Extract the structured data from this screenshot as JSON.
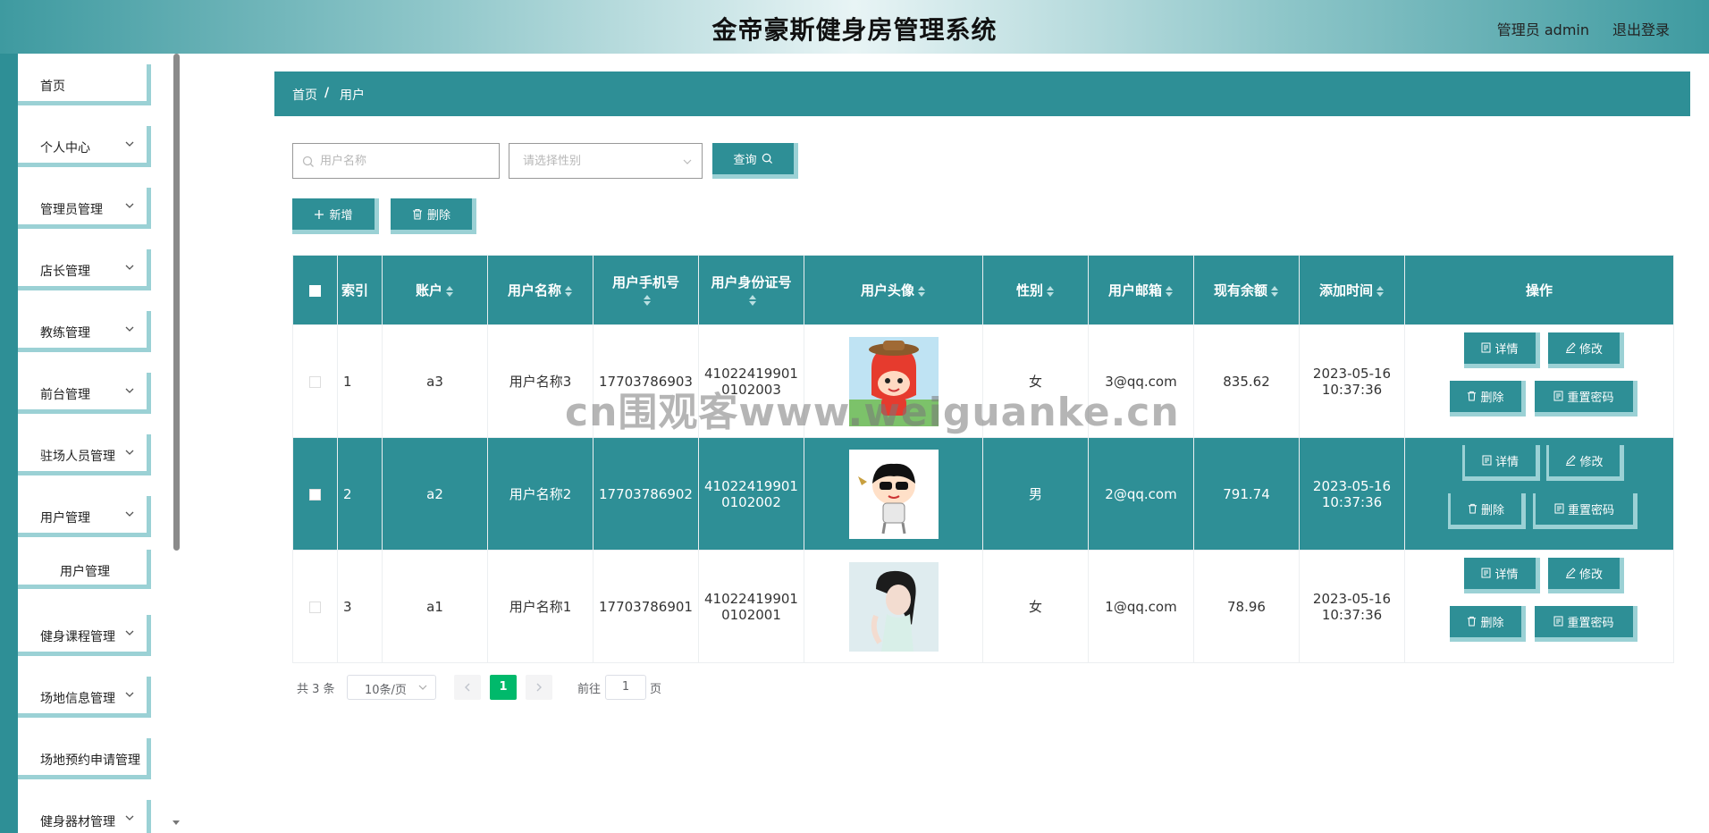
{
  "header": {
    "title": "金帝豪斯健身房管理系统",
    "admin": "管理员 admin",
    "logout": "退出登录"
  },
  "sidebar": {
    "items": [
      {
        "label": "首页"
      },
      {
        "label": "个人中心"
      },
      {
        "label": "管理员管理"
      },
      {
        "label": "店长管理"
      },
      {
        "label": "教练管理"
      },
      {
        "label": "前台管理"
      },
      {
        "label": "驻场人员管理"
      },
      {
        "label": "用户管理"
      },
      {
        "label": "用户管理"
      },
      {
        "label": "健身课程管理"
      },
      {
        "label": "场地信息管理"
      },
      {
        "label": "场地预约申请管理"
      },
      {
        "label": "健身器材管理"
      }
    ]
  },
  "breadcrumb": {
    "home": "首页",
    "sep": "/",
    "current": "用户"
  },
  "search": {
    "name_placeholder": "用户名称",
    "gender_placeholder": "请选择性别",
    "query_label": "查询"
  },
  "actions": {
    "add_label": "新增",
    "delete_label": "删除"
  },
  "table": {
    "headers": [
      "索引",
      "账户",
      "用户名称",
      "用户手机号",
      "用户身份证号",
      "用户头像",
      "性别",
      "用户邮箱",
      "现有余额",
      "添加时间",
      "操作"
    ],
    "rows": [
      {
        "index": "1",
        "account": "a3",
        "name": "用户名称3",
        "phone": "17703786903",
        "idcard": "410224199010102003",
        "gender": "女",
        "email": "3@qq.com",
        "balance": "835.62",
        "date": "2023-05-16",
        "time": "10:37:36"
      },
      {
        "index": "2",
        "account": "a2",
        "name": "用户名称2",
        "phone": "17703786902",
        "idcard": "410224199010102002",
        "gender": "男",
        "email": "2@qq.com",
        "balance": "791.74",
        "date": "2023-05-16",
        "time": "10:37:36"
      },
      {
        "index": "3",
        "account": "a1",
        "name": "用户名称1",
        "phone": "17703786901",
        "idcard": "410224199010102001",
        "gender": "女",
        "email": "1@qq.com",
        "balance": "78.96",
        "date": "2023-05-16",
        "time": "10:37:36"
      }
    ],
    "op_labels": {
      "detail": "详情",
      "edit": "修改",
      "delete": "删除",
      "reset": "重置密码"
    }
  },
  "pagination": {
    "total": "共 3 条",
    "page_size": "10条/页",
    "current": "1",
    "goto": "前往",
    "goto_value": "1",
    "page_unit": "页"
  },
  "watermark": "cn围观客www.weiguanke.cn",
  "colors": {
    "primary": "#2e8f96",
    "accent_border": "#9bd1d5",
    "page_active": "#00b96b"
  }
}
